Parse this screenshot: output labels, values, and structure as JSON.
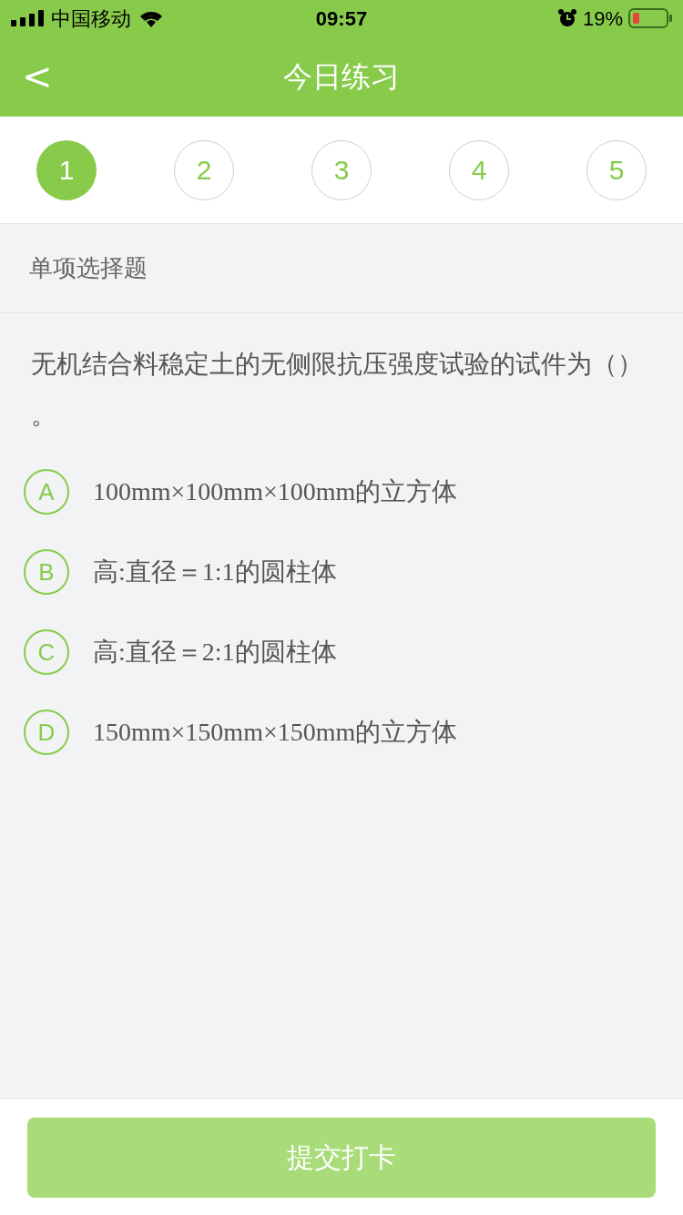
{
  "status_bar": {
    "carrier": "中国移动",
    "time": "09:57",
    "battery": "19%"
  },
  "nav": {
    "back": "<",
    "title": "今日练习"
  },
  "steps": [
    {
      "label": "1",
      "selected": true
    },
    {
      "label": "2",
      "selected": false
    },
    {
      "label": "3",
      "selected": false
    },
    {
      "label": "4",
      "selected": false
    },
    {
      "label": "5",
      "selected": false
    }
  ],
  "section": "单项选择题",
  "question": "无机结合料稳定土的无侧限抗压强度试验的试件为（）。",
  "options": [
    {
      "letter": "A",
      "text": "100mm×100mm×100mm的立方体",
      "selected": false
    },
    {
      "letter": "B",
      "text": "高:直径＝1:1的圆柱体",
      "selected": false
    },
    {
      "letter": "C",
      "text": "高:直径＝2:1的圆柱体",
      "selected": false
    },
    {
      "letter": "D",
      "text": "150mm×150mm×150mm的立方体",
      "selected": false
    }
  ],
  "submit": "提交打卡"
}
